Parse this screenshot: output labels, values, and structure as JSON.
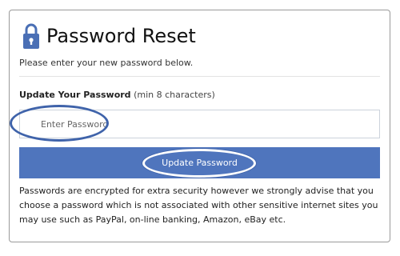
{
  "header": {
    "title": "Password Reset",
    "icon": "padlock-icon",
    "subtitle": "Please enter your new password below."
  },
  "form": {
    "label": "Update Your Password",
    "hint": "(min 8 characters)",
    "password_placeholder": "Enter Password",
    "password_value": "",
    "submit_label": "Update Password"
  },
  "notice": "Passwords are encrypted for extra security however we strongly advise that you choose a password which is not associated with other sensitive internet sites you may use such as PayPal, on-line banking, Amazon, eBay etc.",
  "colors": {
    "button": "#4f75bd",
    "lock_icon": "#4a6fb5",
    "highlight_ring": "#3f63aa"
  }
}
